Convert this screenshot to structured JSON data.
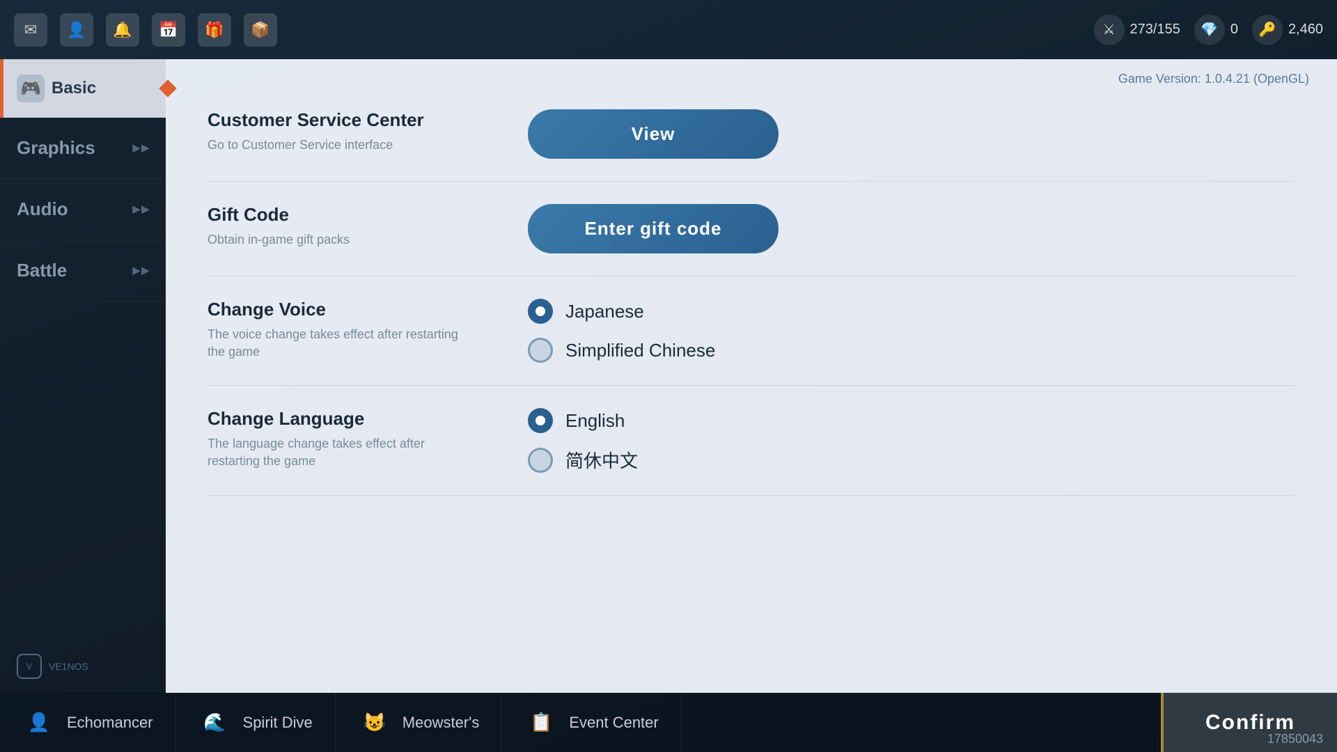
{
  "meta": {
    "game_version": "Game Version: 1.0.4.21 (OpenGL)"
  },
  "top_bar": {
    "stats": [
      {
        "icon": "⚔",
        "value": "273/155"
      },
      {
        "icon": "💎",
        "value": "0"
      },
      {
        "icon": "🔑",
        "value": "2,460"
      }
    ]
  },
  "sidebar": {
    "items": [
      {
        "id": "basic",
        "label": "Basic",
        "active": true
      },
      {
        "id": "graphics",
        "label": "Graphics",
        "active": false
      },
      {
        "id": "audio",
        "label": "Audio",
        "active": false
      },
      {
        "id": "battle",
        "label": "Battle",
        "active": false
      }
    ]
  },
  "settings": {
    "customer_service": {
      "title": "Customer Service Center",
      "desc": "Go to Customer Service interface",
      "button": "View"
    },
    "gift_code": {
      "title": "Gift Code",
      "desc": "Obtain in-game gift packs",
      "button": "Enter gift code"
    },
    "change_voice": {
      "title": "Change Voice",
      "desc": "The voice change takes effect after restarting the game",
      "options": [
        {
          "id": "japanese",
          "label": "Japanese",
          "selected": true
        },
        {
          "id": "simplified_chinese",
          "label": "Simplified Chinese",
          "selected": false
        }
      ]
    },
    "change_language": {
      "title": "Change Language",
      "desc": "The language change takes effect after restarting the game",
      "options": [
        {
          "id": "english",
          "label": "English",
          "selected": true
        },
        {
          "id": "simplified_chinese_zh",
          "label": "简休中文",
          "selected": false
        }
      ]
    }
  },
  "bottom_bar": {
    "nav_items": [
      {
        "id": "echomancer",
        "label": "Echomancer",
        "icon": "👤"
      },
      {
        "id": "spirit_dive",
        "label": "Spirit Dive",
        "icon": "🌊"
      },
      {
        "id": "meowsters",
        "label": "Meowster's",
        "icon": "😺"
      },
      {
        "id": "event_center",
        "label": "Event Center",
        "icon": "📋"
      }
    ],
    "confirm_button": "Confirm"
  },
  "score": "17850043"
}
